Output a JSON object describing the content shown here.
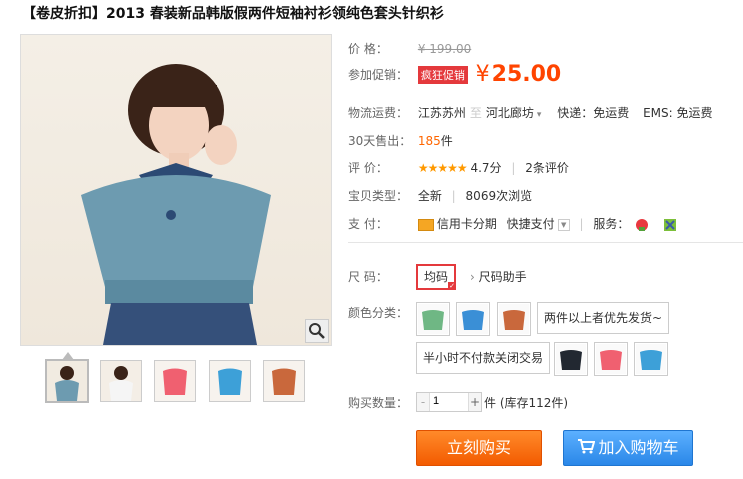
{
  "title": "【卷皮折扣】2013 春装新品韩版假两件短袖衬衫领纯色套头针织衫",
  "price": {
    "label": "价    格：",
    "value": "¥ 199.00"
  },
  "promo": {
    "label": "参加促销：",
    "badge": "疯狂促销",
    "yen": "¥",
    "value": "25.00"
  },
  "shipping": {
    "label": "物流运费：",
    "from": "江苏苏州",
    "divider": "至",
    "to": "河北廊坊",
    "express": "快递：免运费",
    "ems": "EMS: 免运费"
  },
  "sales": {
    "label": "30天售出：",
    "count": "185",
    "unit": "件"
  },
  "rating": {
    "label": "评    价：",
    "stars": "★★★★★",
    "score": "4.7分",
    "reviews": "2条评价"
  },
  "type": {
    "label": "宝贝类型：",
    "condition": "全新",
    "views": "8069次浏览"
  },
  "payment": {
    "label": "支    付：",
    "installment": "信用卡分期",
    "quickpay": "快捷支付",
    "service_label": "服务："
  },
  "size": {
    "label": "尺    码：",
    "selected": "均码",
    "helper": "尺码助手"
  },
  "color": {
    "label": "颜色分类：",
    "text_options": [
      "两件以上者优先发货~",
      "半小时不付款关闭交易"
    ],
    "swatch_colors": [
      "#6fb784",
      "#3a8fd6",
      "#c9683c",
      "#222831",
      "#f06070",
      "#3da0d8"
    ]
  },
  "quantity": {
    "label": "购买数量：",
    "minus": "-",
    "value": "1",
    "plus": "+",
    "unit": "件",
    "stock": "(库存112件)"
  },
  "buttons": {
    "buy": "立刻购买",
    "cart": "加入购物车"
  },
  "colors": {
    "accent": "#f40",
    "buy": "#f35b00",
    "cart": "#2a87e8"
  }
}
